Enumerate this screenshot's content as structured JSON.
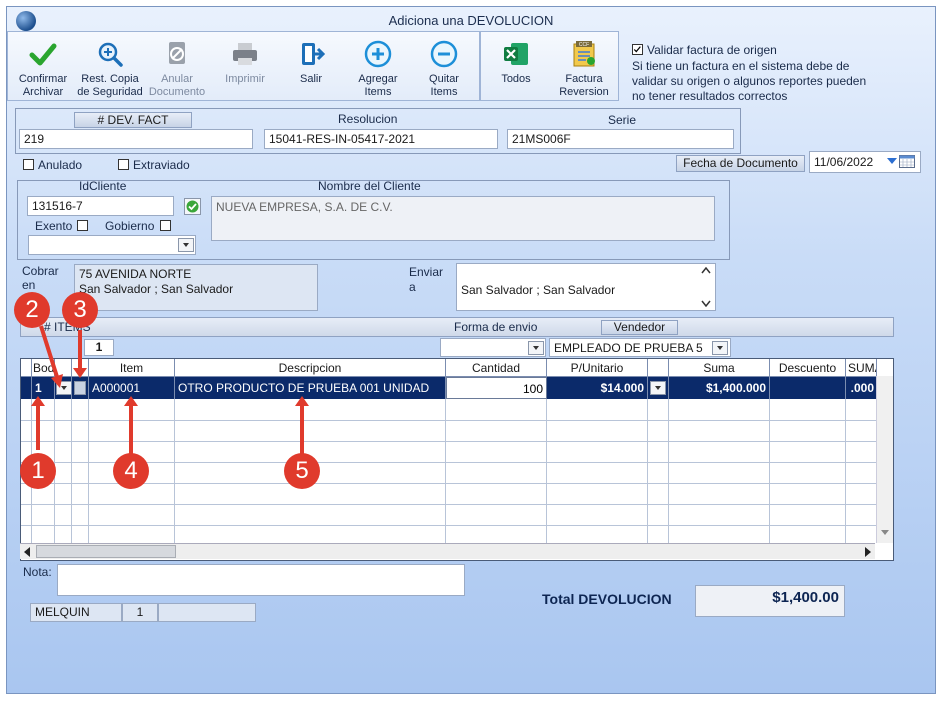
{
  "window": {
    "title": "Adiciona una DEVOLUCION"
  },
  "toolbar": {
    "confirm_l1": "Confirmar",
    "confirm_l2": "Archivar",
    "rest_l1": "Rest. Copia",
    "rest_l2": "de Seguridad",
    "anular_l1": "Anular",
    "anular_l2": "Documento",
    "print": "Imprimir",
    "exit": "Salir",
    "add_l1": "Agregar",
    "add_l2": "Items",
    "remove_l1": "Quitar",
    "remove_l2": "Items",
    "todos": "Todos",
    "factura_l1": "Factura",
    "factura_l2": "Reversion",
    "ccf_badge": "CCF"
  },
  "validate": {
    "label": "Validar factura de origen",
    "checked": true,
    "note_l1": "Si tiene un factura en el sistema debe de",
    "note_l2": "validar su origen o algunos reportes pueden",
    "note_l3": "no tener resultados correctos"
  },
  "header": {
    "dev_label": "# DEV. FACT",
    "dev_value": "219",
    "resol_label": "Resolucion",
    "resol_value": "15041-RES-IN-05417-2021",
    "serie_label": "Serie",
    "serie_value": "21MS006F"
  },
  "flags": {
    "anulado": "Anulado",
    "extraviado": "Extraviado"
  },
  "fecha": {
    "label": "Fecha de  Documento",
    "value": "11/06/2022"
  },
  "client": {
    "id_label": "IdCliente",
    "id_value": "131516-7",
    "name_label": "Nombre del Cliente",
    "name_value": "NUEVA EMPRESA, S.A. DE C.V.",
    "exento": "Exento",
    "gobierno": "Gobierno"
  },
  "cobrar": {
    "label_l1": "Cobrar",
    "label_l2": "en",
    "line1": "75 AVENIDA NORTE",
    "line2": "San Salvador ; San Salvador"
  },
  "enviar": {
    "label_l1": "Enviar",
    "label_l2": "a",
    "value": "San Salvador ; San Salvador"
  },
  "items_bar": {
    "label": "# ITEMS",
    "count": "1",
    "forma_label": "Forma de envio",
    "vendedor_label": "Vendedor",
    "vendedor_value": "EMPLEADO DE PRUEBA 5"
  },
  "grid": {
    "columns": [
      "Bodega",
      "Item",
      "Descripcion",
      "Cantidad",
      "P/Unitario",
      "Suma",
      "Descuento",
      "SUMA"
    ],
    "row": {
      "bodega": "1",
      "item": "A000001",
      "descripcion": "OTRO PRODUCTO DE PRUEBA 001 UNIDAD",
      "cantidad": "100",
      "unitario": "$14.000",
      "suma": "$1,400.000",
      "suma2": ".000"
    }
  },
  "nota": {
    "label": "Nota:"
  },
  "status": {
    "user": "MELQUIN",
    "num": "1"
  },
  "total": {
    "label": "Total DEVOLUCION",
    "value": "$1,400.00"
  },
  "callouts": [
    "1",
    "2",
    "3",
    "4",
    "5"
  ],
  "colors": {
    "callout": "#e03a2c",
    "selected_row": "#0b2a6a"
  }
}
